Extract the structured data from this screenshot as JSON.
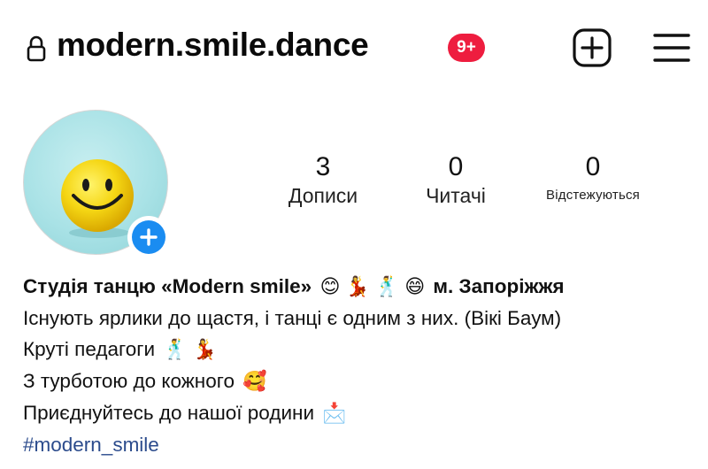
{
  "header": {
    "username": "modern.smile.dance",
    "notification_badge": "9+",
    "icons": {
      "lock": "lock-icon",
      "create": "plus-square-icon",
      "menu": "hamburger-menu-icon"
    },
    "badge_color": "#ee1d3f"
  },
  "profile": {
    "avatar_icon": "smiley-ball-avatar",
    "add_story_icon": "plus-icon",
    "add_story_color": "#1a8cf1"
  },
  "stats": [
    {
      "value": "3",
      "label": "Дописи"
    },
    {
      "value": "0",
      "label": "Читачі"
    },
    {
      "value": "0",
      "label": "Відстежуються"
    }
  ],
  "bio": {
    "name_part1": "Студія танцю «Modern smile»",
    "name_part2": "м. Запоріжжя",
    "line1": "Існують ярлики до щастя, і танці є одним з них. (Вікі Баум)",
    "line2": "Круті педагоги",
    "line3": "З турботою до кожного",
    "line4": "Приєднуйтесь до нашої родини",
    "hashtag": "#modern_smile",
    "emojis": {
      "smile": "😊",
      "dancer_woman": "💃",
      "dancer_man": "🕺",
      "grin": "😄",
      "love_face": "🥰",
      "envelope": "📩"
    },
    "hashtag_color": "#2b4b8c"
  }
}
